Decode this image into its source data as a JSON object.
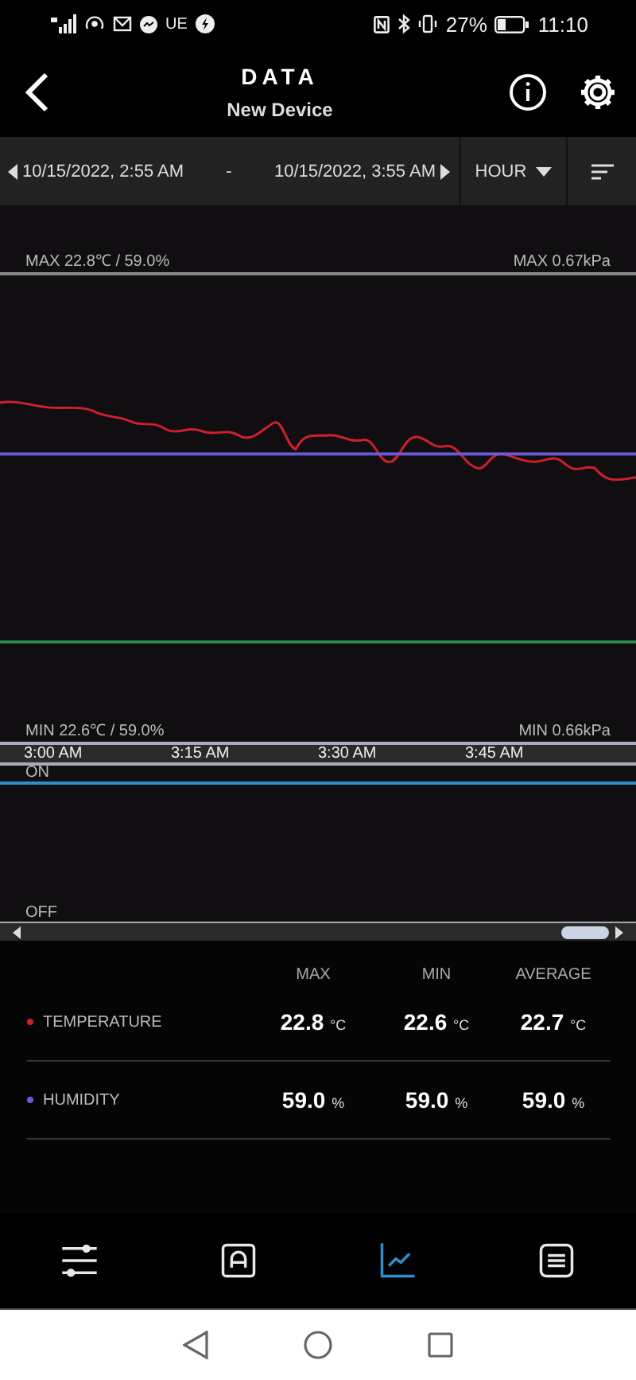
{
  "status_bar": {
    "network": "UE",
    "battery": "27%",
    "time": "11:10"
  },
  "header": {
    "title": "DATA",
    "subtitle": "New Device"
  },
  "range_bar": {
    "start": "10/15/2022, 2:55 AM",
    "separator": "-",
    "end": "10/15/2022, 3:55 AM",
    "interval": "HOUR"
  },
  "chart": {
    "max_left": "MAX 22.8℃ / 59.0%",
    "max_right": "MAX 0.67kPa",
    "min_left": "MIN 22.6℃ / 59.0%",
    "min_right": "MIN 0.66kPa",
    "series": [
      {
        "kind": "curve",
        "color": "#d0202c"
      },
      {
        "kind": "flat",
        "color": "#6a5ad8"
      },
      {
        "kind": "flat",
        "color": "#2f8a4e"
      }
    ],
    "time_labels": [
      "3:00 AM",
      "3:15 AM",
      "3:30 AM",
      "3:45 AM"
    ]
  },
  "switch_chart": {
    "on_label": "ON",
    "off_label": "OFF"
  },
  "stats": {
    "columns": [
      "MAX",
      "MIN",
      "AVERAGE"
    ],
    "rows": [
      {
        "name": "TEMPERATURE",
        "color": "#d0202c",
        "values": [
          {
            "value": "22.8",
            "unit": "°C"
          },
          {
            "value": "22.6",
            "unit": "°C"
          },
          {
            "value": "22.7",
            "unit": "°C"
          }
        ]
      },
      {
        "name": "HUMIDITY",
        "color": "#6a5ad8",
        "values": [
          {
            "value": "59.0",
            "unit": "%"
          },
          {
            "value": "59.0",
            "unit": "%"
          },
          {
            "value": "59.0",
            "unit": "%"
          }
        ]
      }
    ]
  },
  "bottom_nav": [
    {
      "kind": "sliders",
      "selected": false
    },
    {
      "kind": "badge",
      "selected": false
    },
    {
      "kind": "graph",
      "selected": true
    },
    {
      "kind": "list",
      "selected": false
    }
  ]
}
